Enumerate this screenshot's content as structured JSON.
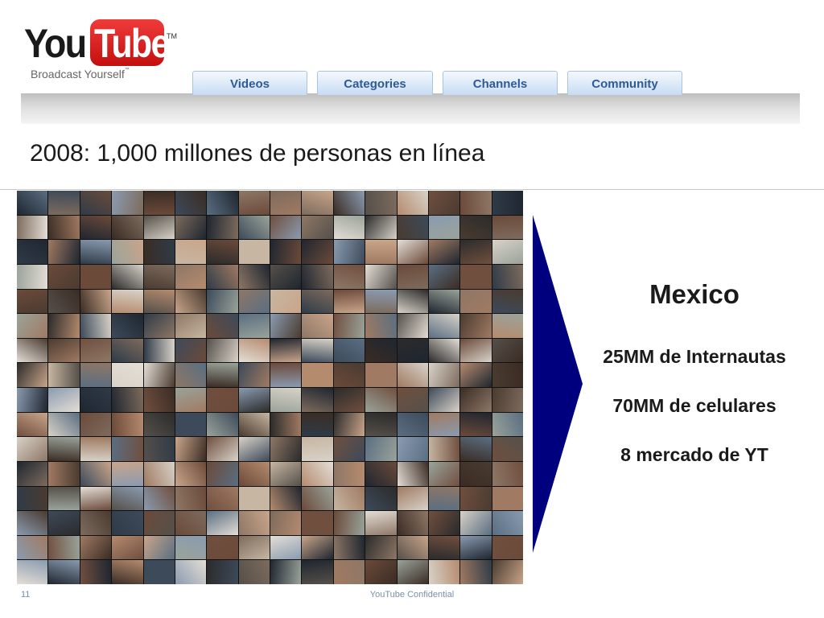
{
  "logo": {
    "you": "You",
    "tube": "Tube",
    "tm": "TM",
    "tagline": "Broadcast Yourself",
    "tagline_tm": "™"
  },
  "nav": {
    "tabs": [
      {
        "label": "Videos"
      },
      {
        "label": "Categories"
      },
      {
        "label": "Channels"
      },
      {
        "label": "Community"
      }
    ]
  },
  "slide": {
    "title": "2008: 1,000 millones de personas en línea",
    "country": "Mexico",
    "stats": [
      "25MM de Internautas",
      "70MM de celulares",
      "8 mercado de YT"
    ]
  },
  "footer": {
    "page_number": "11",
    "confidential": "YouTube Confidential"
  },
  "colors": {
    "arrow": "#00007f",
    "tab_text": "#2d5b97",
    "logo_red": "#d81e1e"
  },
  "icons": {
    "arrow": "chevron-right-icon"
  }
}
